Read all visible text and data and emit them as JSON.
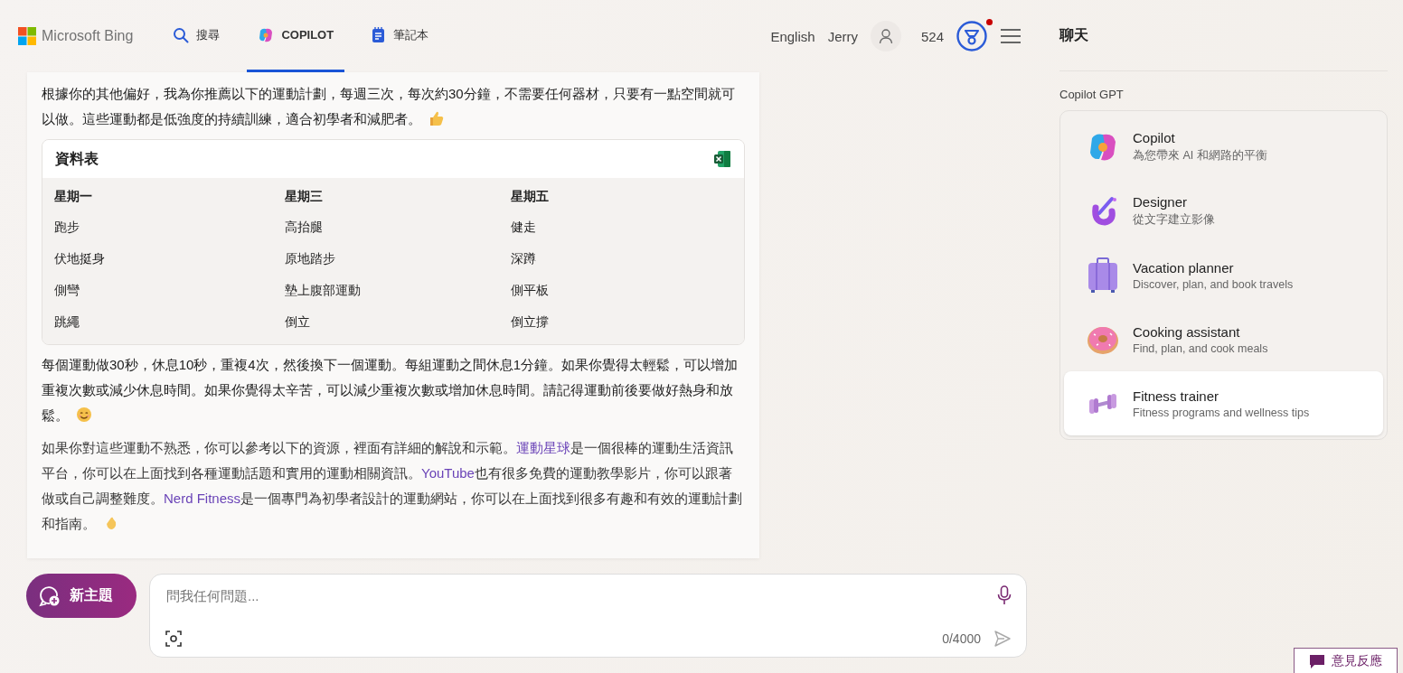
{
  "nav": {
    "brand": "Microsoft Bing",
    "tabs": [
      {
        "label": "搜尋",
        "selected": false
      },
      {
        "label": "COPILOT",
        "selected": true
      },
      {
        "label": "筆記本",
        "selected": false
      }
    ],
    "language": "English",
    "user": "Jerry",
    "points": "524",
    "rewards_notification": true
  },
  "chat": {
    "messages": [
      {
        "kind": "text",
        "segments": [
          {
            "kind": "text",
            "text": "根據你的其他偏好，我為你推薦以下的運動計劃，每週三次，每次約30分鐘，不需要任何器材，只要有一點空間就可以做。這些運動都是低強度的持續訓練，適合初學者和減肥者。"
          }
        ]
      },
      {
        "kind": "table",
        "title": "資料表",
        "columns": [
          "星期一",
          "星期三",
          "星期五"
        ],
        "rows": [
          [
            "跑步",
            "高抬腿",
            "健走"
          ],
          [
            "伏地挺身",
            "原地踏步",
            "深蹲"
          ],
          [
            "側彎",
            "墊上腹部運動",
            "側平板"
          ],
          [
            "跳繩",
            "倒立",
            "倒立撐"
          ]
        ]
      },
      {
        "kind": "text",
        "segments": [
          {
            "kind": "text",
            "text": "每個運動做30秒，休息10秒，重複4次，然後換下一個運動。每組運動之間休息1分鐘。如果你覺得太輕鬆，可以增加重複次數或減少休息時間。如果你覺得太辛苦，可以減少重複次數或增加休息時間。請記得運動前後要做好熱身和放鬆。"
          }
        ]
      },
      {
        "kind": "text",
        "segments": [
          {
            "kind": "text",
            "text": "如果你對這些運動不熟悉，你可以參考以下的資源，裡面有詳細的解說和示範。"
          },
          {
            "kind": "link",
            "text": "運動星球"
          },
          {
            "kind": "text",
            "text": "是一個很棒的運動生活資訊平台，你可以在上面找到各種運動話題和實用的運動相關資訊。"
          },
          {
            "kind": "link",
            "text": "YouTube"
          },
          {
            "kind": "text",
            "text": "也有很多免費的運動教學影片，你可以跟著做或自己調整難度。"
          },
          {
            "kind": "link",
            "text": "Nerd Fitness"
          },
          {
            "kind": "text",
            "text": "是一個專門為初學者設計的運動網站，你可以在上面找到很多有趣和有效的運動計劃和指南。"
          }
        ]
      }
    ]
  },
  "composer": {
    "new_topic": "新主題",
    "placeholder": "問我任何問題...",
    "counter": "0/4000"
  },
  "sidebar": {
    "title": "聊天",
    "section": "Copilot GPT",
    "gpts": [
      {
        "name": "Copilot",
        "description": "為您帶來 AI 和網路的平衡",
        "selected": false
      },
      {
        "name": "Designer",
        "description": "從文字建立影像",
        "selected": false
      },
      {
        "name": "Vacation planner",
        "description": "Discover, plan, and book travels",
        "selected": false
      },
      {
        "name": "Cooking assistant",
        "description": "Find, plan, and cook meals",
        "selected": false
      },
      {
        "name": "Fitness trainer",
        "description": "Fitness programs and wellness tips",
        "selected": true
      }
    ]
  },
  "feedback": "意見反應"
}
